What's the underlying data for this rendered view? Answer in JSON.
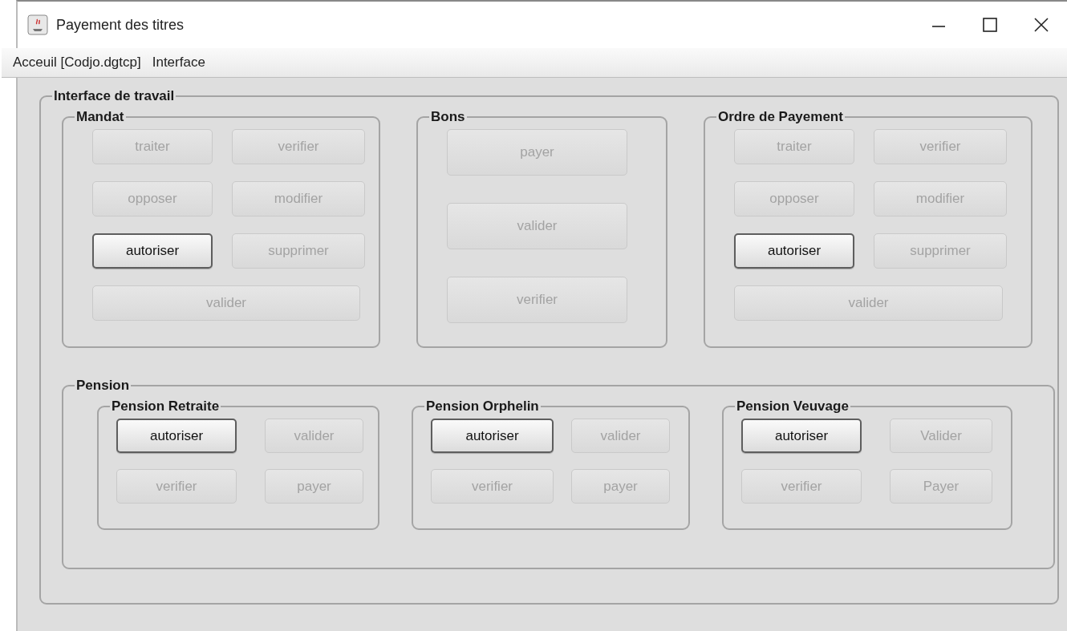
{
  "window": {
    "title": "Payement des titres"
  },
  "menu": [
    {
      "label": "Acceuil [Codjo.dgtcp]"
    },
    {
      "label": "Interface"
    }
  ],
  "workspace": {
    "title": "Interface de travail",
    "groups": [
      {
        "title": "Mandat",
        "buttons": [
          {
            "label": "traiter",
            "disabled": true,
            "kind": "normal"
          },
          {
            "label": "verifier",
            "disabled": true,
            "kind": "normal"
          },
          {
            "label": "opposer",
            "disabled": true,
            "kind": "normal"
          },
          {
            "label": "modifier",
            "disabled": true,
            "kind": "normal"
          },
          {
            "label": "autoriser",
            "disabled": false,
            "kind": "normal"
          },
          {
            "label": "supprimer",
            "disabled": true,
            "kind": "normal"
          },
          {
            "label": "valider",
            "disabled": true,
            "kind": "wide"
          }
        ]
      },
      {
        "title": "Bons",
        "buttons": [
          {
            "label": "payer",
            "disabled": true,
            "kind": "wide"
          },
          {
            "label": "valider",
            "disabled": true,
            "kind": "wide"
          },
          {
            "label": "verifier",
            "disabled": true,
            "kind": "wide"
          }
        ]
      },
      {
        "title": "Ordre de Payement",
        "buttons": [
          {
            "label": "traiter",
            "disabled": true,
            "kind": "normal"
          },
          {
            "label": "verifier",
            "disabled": true,
            "kind": "normal"
          },
          {
            "label": "opposer",
            "disabled": true,
            "kind": "normal"
          },
          {
            "label": "modifier",
            "disabled": true,
            "kind": "normal"
          },
          {
            "label": "autoriser",
            "disabled": false,
            "kind": "normal"
          },
          {
            "label": "supprimer",
            "disabled": true,
            "kind": "normal"
          },
          {
            "label": "valider",
            "disabled": true,
            "kind": "wide"
          }
        ]
      }
    ],
    "pension": {
      "title": "Pension",
      "groups": [
        {
          "title": "Pension Retraite",
          "buttons": [
            {
              "label": "autoriser",
              "disabled": false,
              "kind": "normal"
            },
            {
              "label": "valider",
              "disabled": true,
              "kind": "normal"
            },
            {
              "label": "verifier",
              "disabled": true,
              "kind": "normal"
            },
            {
              "label": "payer",
              "disabled": true,
              "kind": "normal"
            }
          ]
        },
        {
          "title": "Pension Orphelin",
          "buttons": [
            {
              "label": "autoriser",
              "disabled": false,
              "kind": "normal"
            },
            {
              "label": "valider",
              "disabled": true,
              "kind": "normal"
            },
            {
              "label": "verifier",
              "disabled": true,
              "kind": "normal"
            },
            {
              "label": "payer",
              "disabled": true,
              "kind": "normal"
            }
          ]
        },
        {
          "title": "Pension Veuvage",
          "buttons": [
            {
              "label": "autoriser",
              "disabled": false,
              "kind": "normal"
            },
            {
              "label": "Valider",
              "disabled": true,
              "kind": "normal"
            },
            {
              "label": "verifier",
              "disabled": true,
              "kind": "normal"
            },
            {
              "label": "Payer",
              "disabled": true,
              "kind": "normal"
            }
          ]
        }
      ]
    }
  }
}
